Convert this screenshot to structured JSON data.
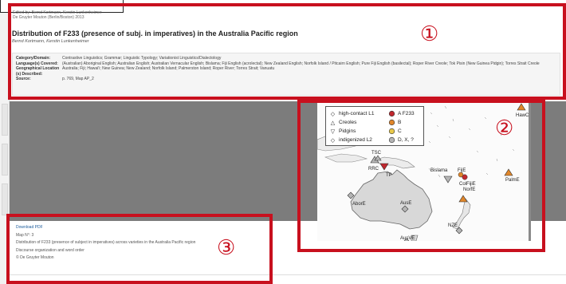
{
  "citation": {
    "line1": "Edited by: Bernd Kortmann, Kerstin Lunkenheimer",
    "line2": "De Gruyter Mouton (Berlin/Boston) 2013"
  },
  "record": {
    "title": "Distribution of F233 (presence of subj. in imperatives) in the Australia Pacific region",
    "authors": "Bernd Kortmann, Kerstin Lunkenheimer"
  },
  "meta": [
    {
      "key": "Category/Domain:",
      "value": "Contrastive Linguistics; Grammar; Linguistic Typology; Variationist Linguistics/Dialectology"
    },
    {
      "key": "Language(s) Covered:",
      "value": "(Australian) Aboriginal English; Australian English; Australian Vernacular English; Bislama; Fiji English (acrolectal); New Zealand English; Norfolk Island / Pitcairn English; Pure Fiji English (basilectal); Roper River Creole; Tok Pisin (New Guinea Pidgin); Torres Strait Creole"
    },
    {
      "key": "Geographical Location (s) Described:",
      "value": "Australia; Fiji; Hawai'i; New Guinea; New Zealand; Norfolk Island; Palmerston Island; Roper River; Torres Strait; Vanuatu"
    },
    {
      "key": "Source:",
      "value": "p. 769, Map AP_2"
    }
  ],
  "legend": {
    "types": [
      {
        "symbol": "◇",
        "label": "high-contact L1"
      },
      {
        "symbol": "△",
        "label": "Creoles"
      },
      {
        "symbol": "▽",
        "label": "Pidgins"
      },
      {
        "symbol": "◇",
        "label": "indigenized L2"
      }
    ],
    "values": [
      {
        "label": "A F233",
        "color": "#c0282f"
      },
      {
        "label": "B",
        "color": "#e0862a"
      },
      {
        "label": "C",
        "color": "#e8c84a"
      },
      {
        "label": "D, X, ?",
        "color": "#b5b5b5"
      }
    ]
  },
  "map_labels": {
    "hawc": "HawC",
    "palme": "PalmE",
    "bislama": "Bislama",
    "fije": "FijE",
    "colfijie": "ColFijiE",
    "norfe": "NorfE",
    "nze": "NZE",
    "ausve": "AusVE",
    "ause": "AusE",
    "abore": "AborE",
    "rrc": "RRC",
    "tp": "TP",
    "tsc": "TSC"
  },
  "download": {
    "link": "Download PDF",
    "map_no": "Map N°: 3",
    "description": "Distribution of F233 (presence of subject in imperatives) across varieties in the Australia Pacific region",
    "subject": "Discourse organization and word order",
    "publisher": "© De Gruyter Mouton"
  },
  "callouts": {
    "one": "①",
    "two": "②",
    "three": "③"
  },
  "colors": {
    "highlight": "#c8101e",
    "band": "#7c7c7c"
  }
}
